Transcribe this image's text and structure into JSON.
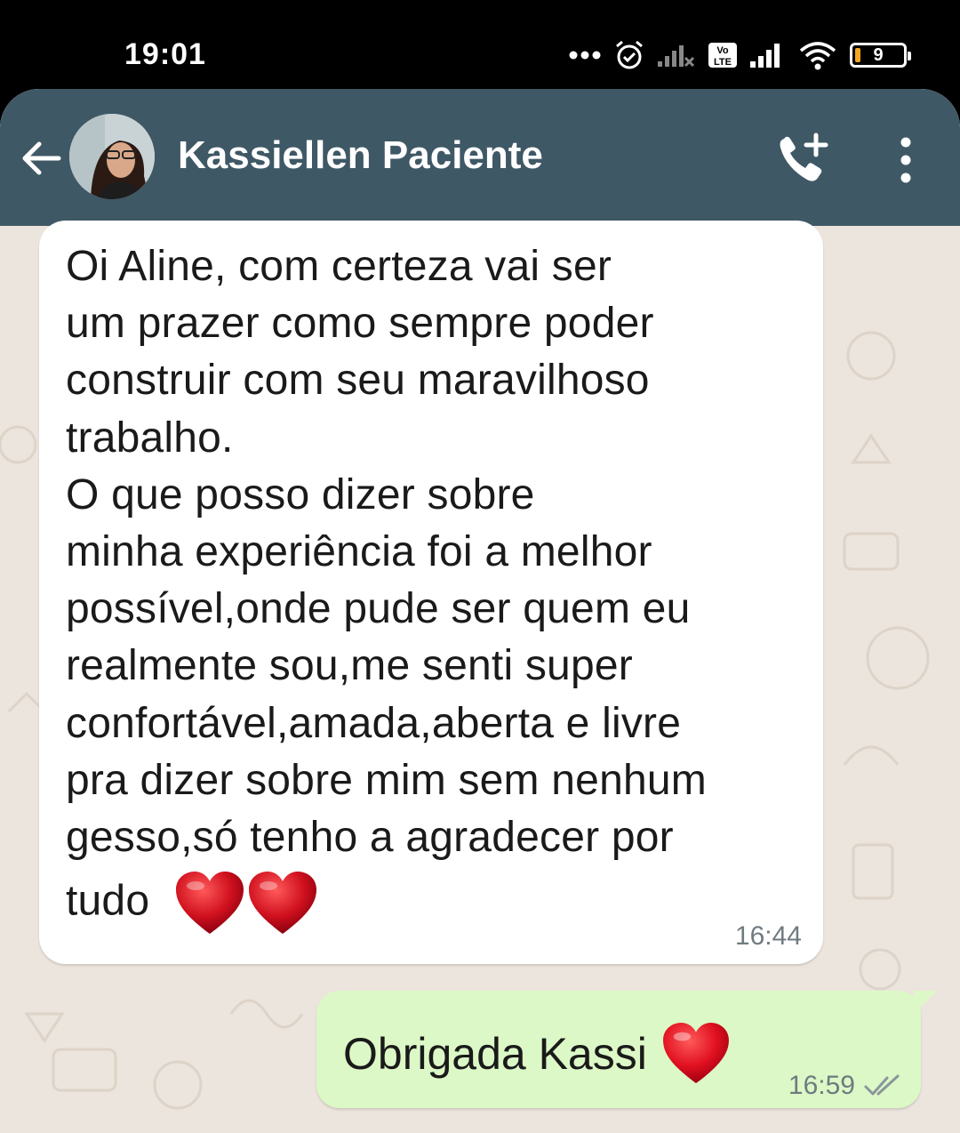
{
  "status_bar": {
    "time": "19:01",
    "battery_level": "9"
  },
  "chat_header": {
    "contact_name": "Kassiellen Paciente"
  },
  "messages": {
    "incoming": {
      "lines": [
        "Oi Aline, com certeza vai ser",
        "um prazer como sempre poder",
        "construir com seu maravilhoso",
        "trabalho.",
        "O que posso dizer sobre",
        "minha experiência foi a melhor",
        "possível,onde pude ser quem eu",
        "realmente sou,me senti super",
        "confortável,amada,aberta e livre",
        "pra dizer sobre mim sem nenhum",
        "gesso,só tenho a agradecer por",
        "tudo"
      ],
      "time": "16:44"
    },
    "outgoing": {
      "text": "Obrigada Kassi",
      "time": "16:59"
    }
  },
  "colors": {
    "header": "#3f5866",
    "incoming_bubble": "#ffffff",
    "outgoing_bubble": "#dcf8c6",
    "wallpaper": "#ece5dd",
    "heart": "#d0101e"
  },
  "icons": [
    "back-arrow-icon",
    "add-call-icon",
    "more-options-icon",
    "double-check-icon",
    "heart-emoji",
    "alarm-icon",
    "wifi-icon",
    "signal-icon",
    "battery-icon"
  ]
}
